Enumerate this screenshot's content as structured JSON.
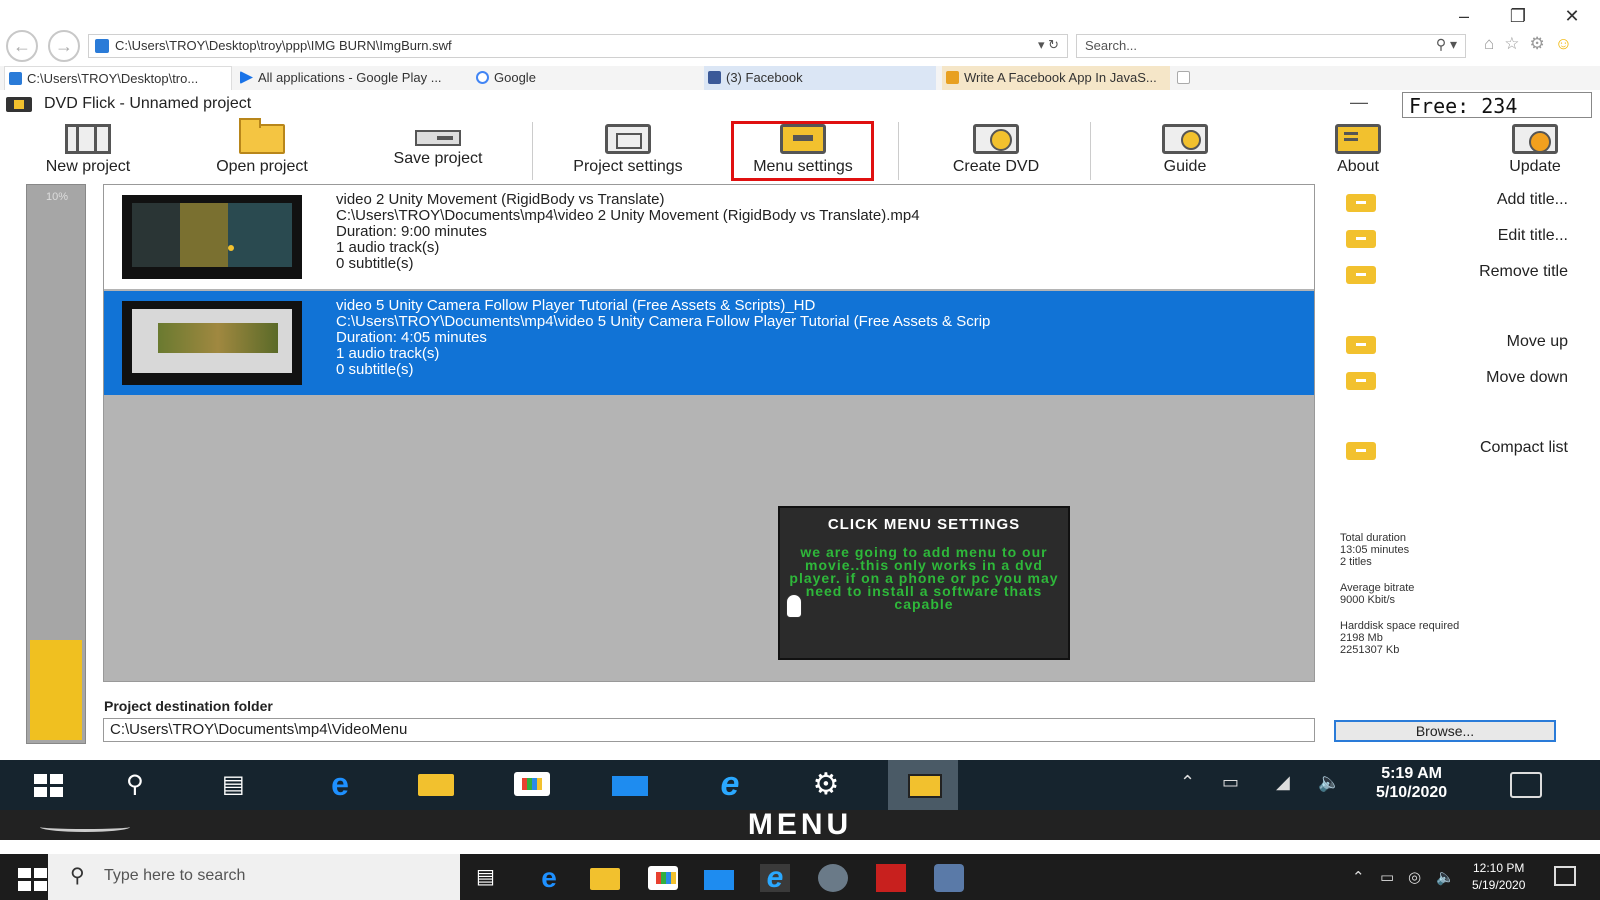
{
  "browser": {
    "address": "C:\\Users\\TROY\\Desktop\\troy\\ppp\\IMG BURN\\ImgBurn.swf",
    "search_placeholder": "Search...",
    "tabs": [
      {
        "label": "C:\\Users\\TROY\\Desktop\\tro..."
      },
      {
        "label": "All applications - Google Play ..."
      },
      {
        "label": "Google"
      },
      {
        "label": "(3) Facebook"
      },
      {
        "label": "Write A Facebook App In JavaS..."
      }
    ]
  },
  "app": {
    "title": "DVD Flick - Unnamed project",
    "free_text": "Free: 234",
    "toolbar": {
      "new_project": "New project",
      "open_project": "Open project",
      "save_project": "Save project",
      "project_settings": "Project settings",
      "menu_settings": "Menu settings",
      "create_dvd": "Create DVD",
      "guide": "Guide",
      "about": "About",
      "update": "Update"
    },
    "gauge": {
      "label": "10%",
      "fill_fraction": 0.18
    },
    "titles": [
      {
        "name": "video 2 Unity Movement (RigidBody vs Translate)",
        "path": "C:\\Users\\TROY\\Documents\\mp4\\video 2 Unity Movement (RigidBody vs Translate).mp4",
        "duration": "Duration: 9:00 minutes",
        "audio": "1 audio track(s)",
        "subtitles": "0 subtitle(s)"
      },
      {
        "name": "video 5 Unity Camera Follow Player Tutorial (Free Assets & Scripts)_HD",
        "path": "C:\\Users\\TROY\\Documents\\mp4\\video 5 Unity Camera Follow Player Tutorial (Free Assets & Scrip",
        "duration": "Duration: 4:05 minutes",
        "audio": "1 audio track(s)",
        "subtitles": "0 subtitle(s)"
      }
    ],
    "overlay": {
      "title": "CLICK MENU SETTINGS",
      "body": "we are going to add menu to our movie..this only works in a dvd player. if on a phone or pc you may need to install a software thats capable"
    },
    "side_buttons": {
      "add_title": "Add title...",
      "edit_title": "Edit title...",
      "remove_title": "Remove title",
      "move_up": "Move up",
      "move_down": "Move down",
      "compact_list": "Compact list"
    },
    "stats": {
      "total_duration_label": "Total duration",
      "total_duration_value": "13:05 minutes",
      "titles_count": "2 titles",
      "avg_bitrate_label": "Average bitrate",
      "avg_bitrate_value": "9000 Kbit/s",
      "space_label": "Harddisk space required",
      "space_mb": "2198 Mb",
      "space_kb": "2251307 Kb"
    },
    "destination": {
      "label": "Project destination folder",
      "value": "C:\\Users\\TROY\\Documents\\mp4\\VideoMenu",
      "browse": "Browse..."
    }
  },
  "inner_taskbar": {
    "time": "5:19 AM",
    "date": "5/10/2020"
  },
  "banner": {
    "text": "MENU"
  },
  "outer_taskbar": {
    "search_placeholder": "Type here to search",
    "time": "12:10 PM",
    "date": "5/19/2020"
  },
  "colors": {
    "selection": "#1173d6",
    "accent_yellow": "#f2c12e",
    "highlight_red": "#e01010",
    "overlay_green": "#2eb83a"
  }
}
